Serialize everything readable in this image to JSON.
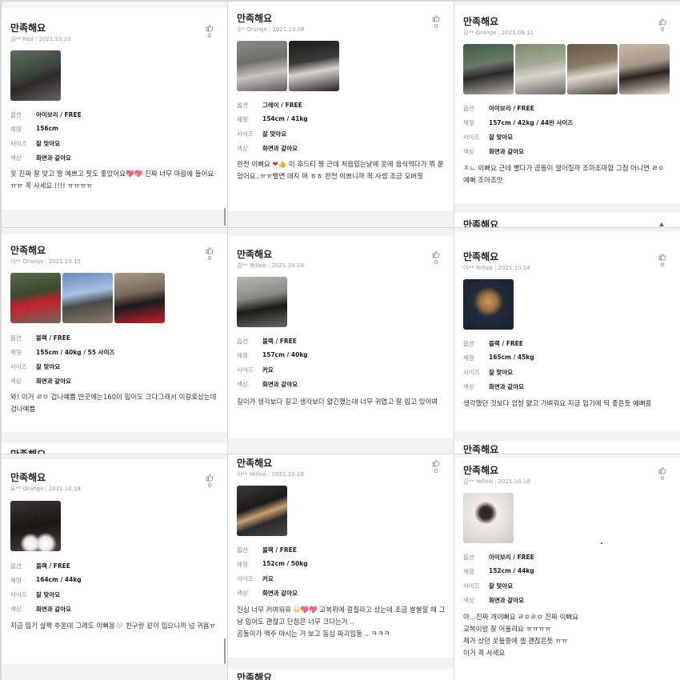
{
  "reviews": [
    {
      "title": "만족해요",
      "author": "김** Red",
      "date": "2021.10.10",
      "likes": "0",
      "options": [
        {
          "k": "옵션",
          "v": "아이보리 / FREE"
        },
        {
          "k": "체형",
          "v": "156cm"
        },
        {
          "k": "사이즈",
          "v": "잘 맞아요"
        },
        {
          "k": "색상",
          "v": "화면과 같아요"
        }
      ],
      "text_a": "옷 진짜 잘 맞고 짱 예쁘고 핏도 좋았어요",
      "text_b": " 진짜 너무 마음에 들어요 ㅠㅠ 꼭 사세요 !!!! ㅠㅠㅠㅠ",
      "photo_colors": [
        "#4a5a4a"
      ]
    },
    {
      "title": "만족해요",
      "author": "수* Orange",
      "date": "2021.10.08",
      "likes": "0",
      "options": [
        {
          "k": "옵션",
          "v": "그레이 / FREE"
        },
        {
          "k": "체형",
          "v": "154cm / 41kg"
        },
        {
          "k": "사이즈",
          "v": "잘 맞아요"
        },
        {
          "k": "색상",
          "v": "화면과 같아요"
        }
      ],
      "text_a": "완전 이뻐요",
      "text_b": " 이 후드티 짱 근데 처음입는날에 옷에 음식먹다가 뭐 묻었어요..ㅠㅠ빨면 데지 머 ㅎㅎ 완전 이쁘니까 꼭 사셈 조금 오버핏",
      "photo_colors": [
        "#7a7a78",
        "#2f2f2f"
      ]
    },
    {
      "title": "만족해요",
      "author": "김** Orange",
      "date": "2021.09.11",
      "likes": "0",
      "options": [
        {
          "k": "옵션",
          "v": "아이보리 / FREE"
        },
        {
          "k": "체형",
          "v": "157cm / 42kg / 44반 사이즈"
        },
        {
          "k": "사이즈",
          "v": "잘 맞아요"
        },
        {
          "k": "색상",
          "v": "화면과 같아요"
        }
      ],
      "text_a": "ㅈㄴ 이뻐요 근데 빨다가 곰돌이 떨어질까 조마조마함 그점 아니면 ㄹㅇ 예뻐 조아조앗",
      "text_b": "",
      "next_title": "만족해요",
      "photo_colors": [
        "#4f6a55",
        "#8a8f7a",
        "#6a5e52",
        "#b9a89a"
      ]
    },
    {
      "title": "만족해요",
      "author": "이** Orange",
      "date": "2021.10.15",
      "likes": "0",
      "options": [
        {
          "k": "옵션",
          "v": "블랙 / FREE"
        },
        {
          "k": "체형",
          "v": "155cm / 40kg / 55 사이즈"
        },
        {
          "k": "사이즈",
          "v": "잘 맞아요"
        },
        {
          "k": "색상",
          "v": "화면과 같아요"
        }
      ],
      "text_a": "와! 이거 ㄹㅇ 겁나예쁨 딴곳에는160이 입어도 크다그래서 이걸로샀는데 검나예쁨",
      "text_b": "",
      "next_title": "만족해요",
      "photo_colors": [
        "#5a6a4a",
        "#7a8fb0",
        "#8a7a68"
      ]
    },
    {
      "title": "만족해요",
      "author": "김** Yellow",
      "date": "2021.10.14",
      "likes": "0",
      "options": [
        {
          "k": "옵션",
          "v": "블랙 / FREE"
        },
        {
          "k": "체형",
          "v": "157cm / 40kg"
        },
        {
          "k": "사이즈",
          "v": "커요"
        },
        {
          "k": "색상",
          "v": "화면과 같아요"
        }
      ],
      "text_a": "길이가 생각보다 길고 생각보다 얇긴했는데 너무 귀엽고 잘 입고 있어여",
      "text_b": "",
      "photo_colors": [
        "#9a9a94"
      ]
    },
    {
      "title": "만족해요",
      "author": "이** Yellow",
      "date": "2021.10.14",
      "likes": "0",
      "options": [
        {
          "k": "옵션",
          "v": "블랙 / FREE"
        },
        {
          "k": "체형",
          "v": "165cm / 45kg"
        },
        {
          "k": "사이즈",
          "v": "잘 맞아요"
        },
        {
          "k": "색상",
          "v": "화면과 같아요"
        }
      ],
      "text_a": "생각했던 것보다 엄청 얇고 가벼워요 지금 입기에 딱 좋은듯 예뻐용",
      "text_b": "",
      "next_title": "만족해요",
      "photo_colors": [
        "#1f2a3a"
      ]
    },
    {
      "title": "만족해요",
      "author": "유** Orange",
      "date": "2021.10.18",
      "likes": "0",
      "options": [
        {
          "k": "옵션",
          "v": "블랙 / FREE"
        },
        {
          "k": "체형",
          "v": "164cm / 44kg"
        },
        {
          "k": "사이즈",
          "v": "잘 맞아요"
        },
        {
          "k": "색상",
          "v": "화면과 같아요"
        }
      ],
      "text_a": "지금 입기 살짝 추운데 그래도 이뻐용",
      "text_b": " 친구랑 같이 입으니까 넘 귀욤ㅠ",
      "photo_colors": [
        "#2a2622"
      ]
    },
    {
      "title": "만족해요",
      "author": "이** Yellow",
      "date": "2021.10.19",
      "likes": "0",
      "options": [
        {
          "k": "옵션",
          "v": "블랙 / FREE"
        },
        {
          "k": "체형",
          "v": "152cm / 50kg"
        },
        {
          "k": "사이즈",
          "v": "커요"
        },
        {
          "k": "색상",
          "v": "화면과 같아요"
        }
      ],
      "text_a": "진심 너무 커여워유",
      "text_b": " 교복위에 걸칠라고 샀는데 조금 쌀쌀할 때 그냥 입어도 괜찮고 단점은 너무 크다는거 ..",
      "text_c": "곰돌이가 맥주 마시는 거 보고 동심 파괴임둥 .. ㅋㅋㅋ",
      "next_title": "만족해요",
      "photo_colors": [
        "#2a2a2a"
      ]
    },
    {
      "title": "만족해요",
      "author": "김** Yellow",
      "date": "2021.10.18",
      "likes": "0",
      "options": [
        {
          "k": "옵션",
          "v": "아이보리 / FREE"
        },
        {
          "k": "체형",
          "v": "152cm / 44kg"
        },
        {
          "k": "사이즈",
          "v": "잘 맞아요"
        },
        {
          "k": "색상",
          "v": "화면과 같아요"
        }
      ],
      "lines": [
        "아...진짜 개이뻐요 ㄹㅇㄹㅇ 진짜 이뻐요",
        "교복이랑 잘 어울려요 ㅠㅠㅠㅠ",
        "제가 샀던 옷들중에 젤 괜찮은듯 ㅠㅠ",
        "이거 꼭 사세요"
      ],
      "photo_colors": [
        "#e8e4e0"
      ]
    }
  ]
}
